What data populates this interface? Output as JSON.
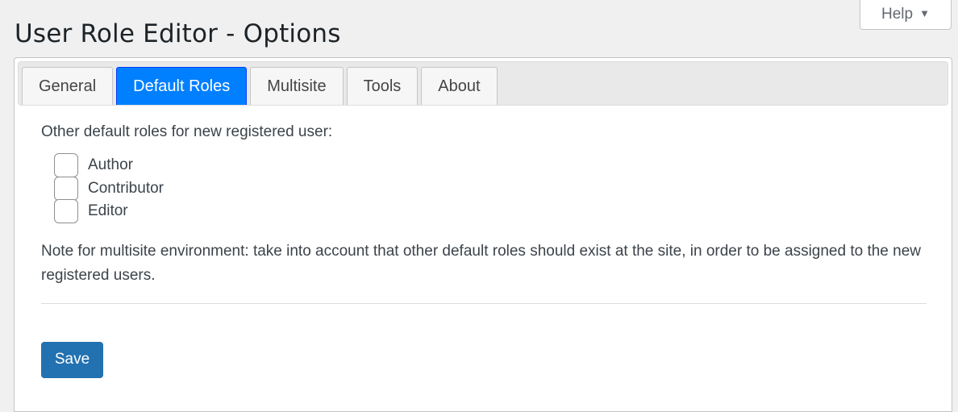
{
  "help": {
    "label": "Help",
    "arrow": "▼"
  },
  "page": {
    "title": "User Role Editor - Options"
  },
  "tabs": [
    {
      "label": "General",
      "active": false
    },
    {
      "label": "Default Roles",
      "active": true
    },
    {
      "label": "Multisite",
      "active": false
    },
    {
      "label": "Tools",
      "active": false
    },
    {
      "label": "About",
      "active": false
    }
  ],
  "default_roles": {
    "intro": "Other default roles for new registered user:",
    "roles": [
      {
        "label": "Author",
        "checked": false
      },
      {
        "label": "Contributor",
        "checked": false
      },
      {
        "label": "Editor",
        "checked": false
      }
    ],
    "note": "Note for multisite environment: take into account that other default roles should exist at the site, in order to be assigned to the new registered users."
  },
  "actions": {
    "save_label": "Save"
  },
  "colors": {
    "active_tab": "#007fff",
    "primary_button": "#2271b1",
    "background": "#f0f0f1"
  }
}
